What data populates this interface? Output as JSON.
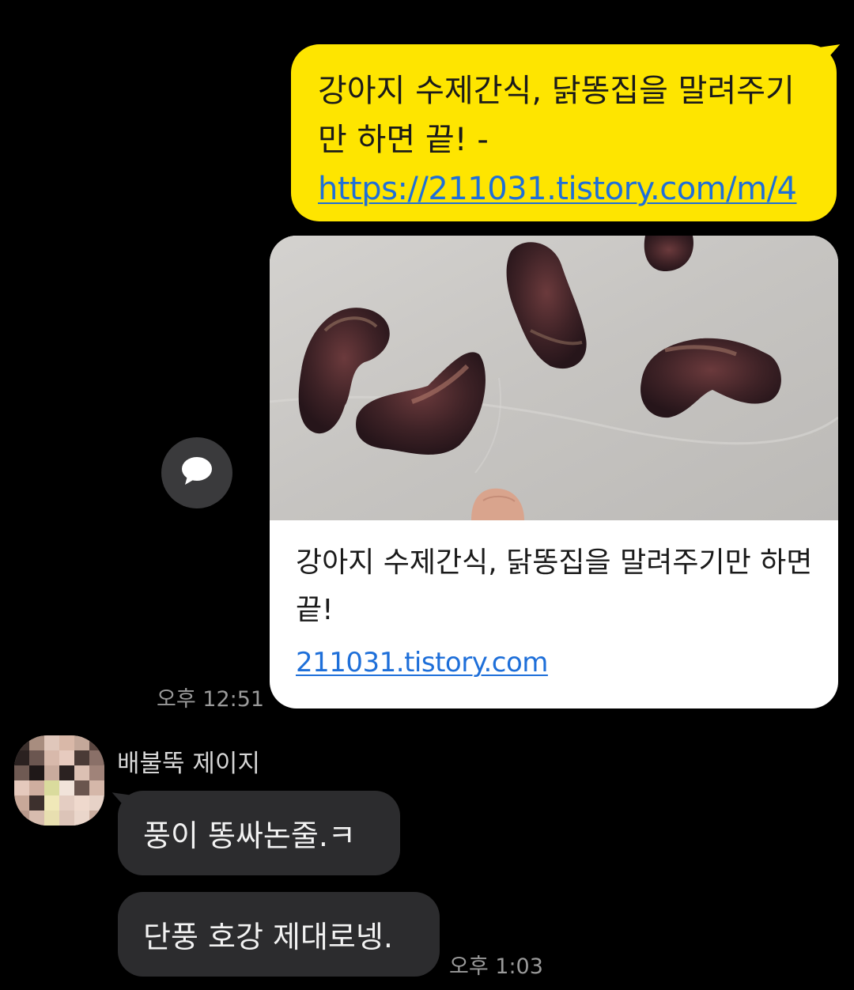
{
  "outgoing": {
    "text": "강아지 수제간식, 닭똥집을 말려주기만 하면 끝! -",
    "link": "https://211031.tistory.com/m/4",
    "time": "오후 12:51"
  },
  "link_preview": {
    "title": "강아지 수제간식, 닭똥집을 말려주기만 하면 끝!",
    "domain": "211031.tistory.com",
    "image": "dried chicken gizzards on parchment"
  },
  "share_button": {
    "icon": "speech-bubble-icon"
  },
  "incoming": {
    "sender": "배불뚝 제이지",
    "messages": [
      {
        "text": "풍이 똥싸논줄.ㅋ"
      },
      {
        "text": "단풍 호강 제대로넹."
      }
    ],
    "time": "오후 1:03"
  },
  "colors": {
    "background": "#000000",
    "outgoing_bubble": "#fee500",
    "incoming_bubble": "#2c2c2e",
    "link": "#1e6fd9",
    "timestamp": "#9a9a9a"
  }
}
